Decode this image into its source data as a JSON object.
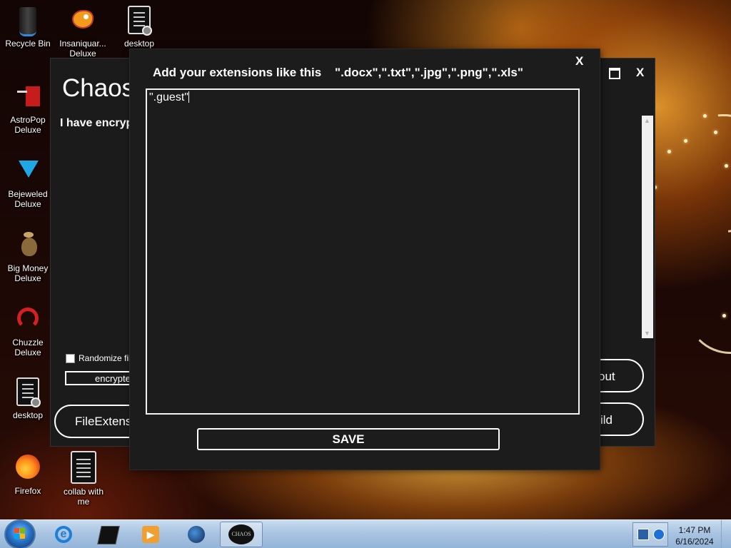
{
  "desktop": {
    "icons": [
      {
        "label": "Recycle Bin"
      },
      {
        "label": "Insaniquar... Deluxe"
      },
      {
        "label": "desktop"
      },
      {
        "label": "AstroPop Deluxe"
      },
      {
        "label": "Bejeweled Deluxe"
      },
      {
        "label": "Big Money Deluxe"
      },
      {
        "label": "Chuzzle Deluxe"
      },
      {
        "label": "desktop"
      },
      {
        "label": "Firefox"
      },
      {
        "label": "collab with me"
      }
    ]
  },
  "main_window": {
    "title": "Chaos",
    "subtitle": "I have encryp",
    "close_label": "X",
    "randomize_label": "Randomize file",
    "encrypt_field_value": "encrypte",
    "file_extensions_button": "FileExtensi",
    "about_button": "out",
    "build_button": "ild"
  },
  "dialog": {
    "prompt": "Add your extensions like this    \".docx\",\".txt\",\".jpg\",\".png\",\".xls\"",
    "close_label": "X",
    "textarea_value": "\".guest\"",
    "save_button": "SAVE"
  },
  "taskbar": {
    "chaos_label": "CHAOS",
    "time": "1:47 PM",
    "date": "6/16/2024"
  },
  "colors": {
    "window_bg": "#1b1b1b",
    "taskbar": "#a9c4e2",
    "text": "#ffffff"
  }
}
